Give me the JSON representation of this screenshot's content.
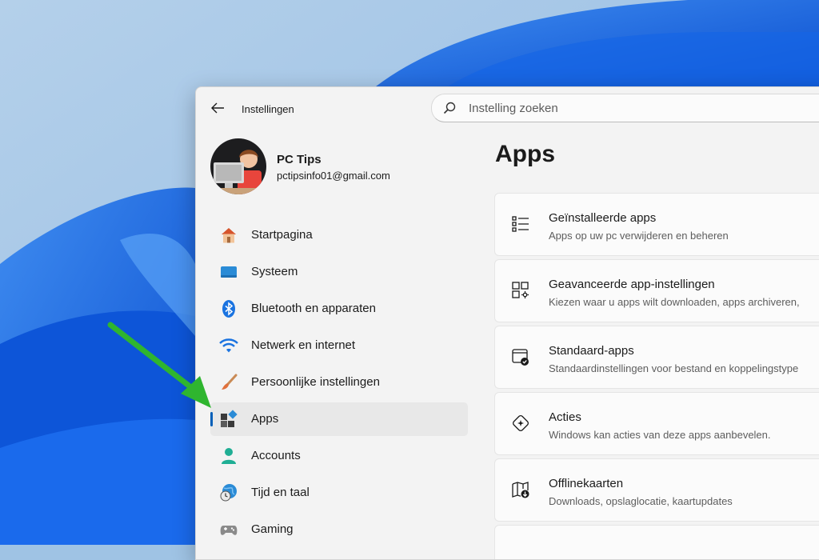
{
  "window": {
    "title": "Instellingen",
    "search_placeholder": "Instelling zoeken"
  },
  "profile": {
    "name": "PC Tips",
    "email": "pctipsinfo01@gmail.com"
  },
  "sidebar": {
    "items": [
      {
        "label": "Startpagina",
        "icon": "home-icon"
      },
      {
        "label": "Systeem",
        "icon": "monitor-icon"
      },
      {
        "label": "Bluetooth en apparaten",
        "icon": "bluetooth-icon"
      },
      {
        "label": "Netwerk en internet",
        "icon": "wifi-icon"
      },
      {
        "label": "Persoonlijke instellingen",
        "icon": "brush-icon"
      },
      {
        "label": "Apps",
        "icon": "apps-icon",
        "selected": true
      },
      {
        "label": "Accounts",
        "icon": "account-icon"
      },
      {
        "label": "Tijd en taal",
        "icon": "clock-globe-icon"
      },
      {
        "label": "Gaming",
        "icon": "gamepad-icon"
      }
    ]
  },
  "main": {
    "title": "Apps",
    "cards": [
      {
        "title": "Geïnstalleerde apps",
        "subtitle": "Apps op uw pc verwijderen en beheren",
        "icon": "list-icon"
      },
      {
        "title": "Geavanceerde app-instellingen",
        "subtitle": "Kiezen waar u apps wilt downloaden, apps archiveren,",
        "icon": "app-settings-icon"
      },
      {
        "title": "Standaard-apps",
        "subtitle": "Standaardinstellingen voor bestand en koppelingstype",
        "icon": "default-apps-icon"
      },
      {
        "title": "Acties",
        "subtitle": "Windows kan acties van deze apps aanbevelen.",
        "icon": "actions-icon"
      },
      {
        "title": "Offlinekaarten",
        "subtitle": "Downloads, opslaglocatie, kaartupdates",
        "icon": "offline-map-icon"
      }
    ]
  },
  "colors": {
    "accent": "#005fb8",
    "annotation_arrow": "#2fb52f"
  }
}
